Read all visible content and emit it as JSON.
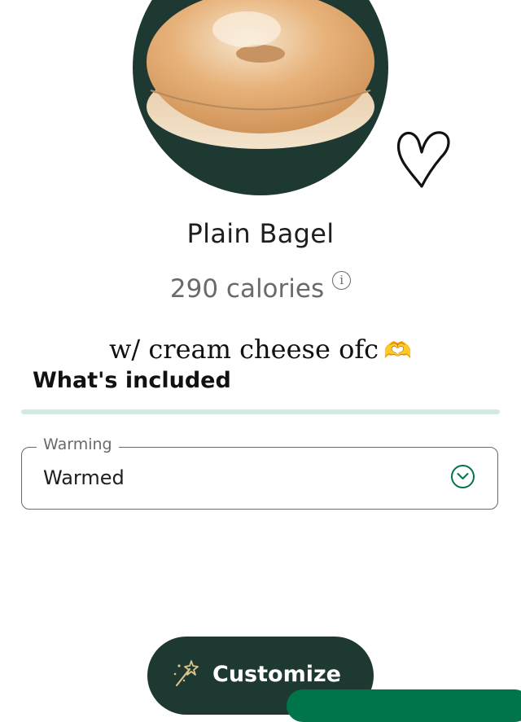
{
  "product": {
    "name": "Plain Bagel",
    "calories": "290 calories",
    "info_icon": "i"
  },
  "overlay": {
    "note": "w/ cream cheese ofc",
    "emoji": "🫶"
  },
  "included": {
    "heading": "What's included"
  },
  "warming": {
    "label": "Warming",
    "value": "Warmed"
  },
  "actions": {
    "customize_label": "Customize"
  },
  "colors": {
    "brand_dark": "#1e3932",
    "brand_green": "#00754a",
    "divider": "#d4e9e2",
    "muted_text": "#6a6a6a"
  },
  "icons": {
    "info": "info-icon",
    "chevron": "chevron-down-icon",
    "wand": "magic-wand-icon",
    "heart": "heart-doodle"
  }
}
